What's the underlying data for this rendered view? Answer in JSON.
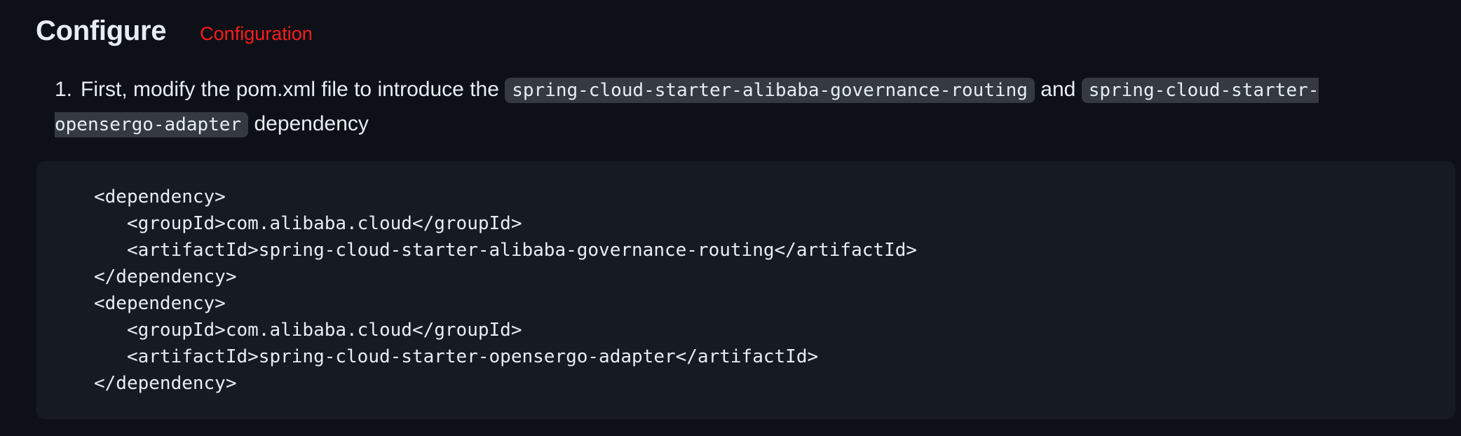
{
  "section": {
    "title": "Configure",
    "title_annotation": "Configuration"
  },
  "step1": {
    "number": "1.",
    "text_before": "First, modify the pom.xml file to introduce the ",
    "code_1": "spring-cloud-starter-alibaba-governance-routing",
    "text_middle": " and ",
    "code_2": "spring-cloud-starter-opensergo-adapter",
    "text_after": " dependency"
  },
  "code_block": {
    "lines": [
      "<dependency>",
      "   <groupId>com.alibaba.cloud</groupId>",
      "   <artifactId>spring-cloud-starter-alibaba-governance-routing</artifactId>",
      "</dependency>",
      "<dependency>",
      "   <groupId>com.alibaba.cloud</groupId>",
      "   <artifactId>spring-cloud-starter-opensergo-adapter</artifactId>",
      "</dependency>"
    ]
  }
}
